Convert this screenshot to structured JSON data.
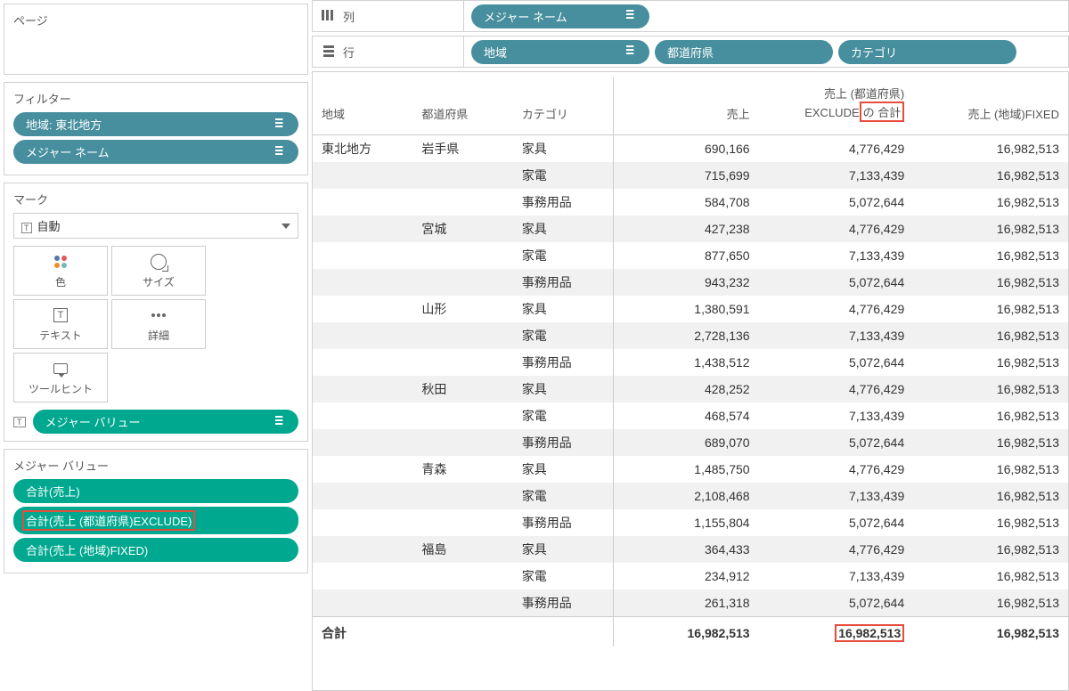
{
  "left": {
    "pages": {
      "title": "ページ"
    },
    "filters": {
      "title": "フィルター",
      "items": [
        {
          "label": "地域: 東北地方"
        },
        {
          "label": "メジャー ネーム"
        }
      ]
    },
    "marks": {
      "title": "マーク",
      "select_label": "自動",
      "buttons": {
        "color": "色",
        "size": "サイズ",
        "text": "テキスト",
        "detail": "詳細",
        "tooltip": "ツールヒント"
      },
      "measure_value_pill": "メジャー バリュー"
    },
    "measure_values": {
      "title": "メジャー バリュー",
      "items": [
        {
          "label": "合計(売上)"
        },
        {
          "label": "合計(売上 (都道府県)EXCLUDE)",
          "highlight": true
        },
        {
          "label": "合計(売上 (地域)FIXED)"
        }
      ]
    }
  },
  "shelves": {
    "columns": {
      "label": "列",
      "pills": [
        "メジャー ネーム"
      ]
    },
    "rows": {
      "label": "行",
      "pills": [
        "地域",
        "都道府県",
        "カテゴリ"
      ]
    }
  },
  "table": {
    "headers": {
      "region": "地域",
      "prefecture": "都道府県",
      "category": "カテゴリ",
      "sales": "売上",
      "exclude_line1": "売上 (都道府県)",
      "exclude_line2a": "EXCLUDE",
      "exclude_line2b": " の 合計",
      "fixed": "売上 (地域)FIXED"
    },
    "region_value": "東北地方",
    "total_label": "合計",
    "totals": {
      "sales": "16,982,513",
      "exclude": "16,982,513",
      "fixed": "16,982,513"
    },
    "prefectures": [
      {
        "name": "岩手県",
        "rows": [
          {
            "cat": "家具",
            "sales": "690,166",
            "exclude": "4,776,429",
            "fixed": "16,982,513"
          },
          {
            "cat": "家電",
            "sales": "715,699",
            "exclude": "7,133,439",
            "fixed": "16,982,513",
            "stripe": true
          },
          {
            "cat": "事務用品",
            "sales": "584,708",
            "exclude": "5,072,644",
            "fixed": "16,982,513"
          }
        ]
      },
      {
        "name": "宮城",
        "rows": [
          {
            "cat": "家具",
            "sales": "427,238",
            "exclude": "4,776,429",
            "fixed": "16,982,513",
            "stripe": true
          },
          {
            "cat": "家電",
            "sales": "877,650",
            "exclude": "7,133,439",
            "fixed": "16,982,513"
          },
          {
            "cat": "事務用品",
            "sales": "943,232",
            "exclude": "5,072,644",
            "fixed": "16,982,513",
            "stripe": true
          }
        ]
      },
      {
        "name": "山形",
        "rows": [
          {
            "cat": "家具",
            "sales": "1,380,591",
            "exclude": "4,776,429",
            "fixed": "16,982,513"
          },
          {
            "cat": "家電",
            "sales": "2,728,136",
            "exclude": "7,133,439",
            "fixed": "16,982,513",
            "stripe": true
          },
          {
            "cat": "事務用品",
            "sales": "1,438,512",
            "exclude": "5,072,644",
            "fixed": "16,982,513"
          }
        ]
      },
      {
        "name": "秋田",
        "rows": [
          {
            "cat": "家具",
            "sales": "428,252",
            "exclude": "4,776,429",
            "fixed": "16,982,513",
            "stripe": true
          },
          {
            "cat": "家電",
            "sales": "468,574",
            "exclude": "7,133,439",
            "fixed": "16,982,513"
          },
          {
            "cat": "事務用品",
            "sales": "689,070",
            "exclude": "5,072,644",
            "fixed": "16,982,513",
            "stripe": true
          }
        ]
      },
      {
        "name": "青森",
        "rows": [
          {
            "cat": "家具",
            "sales": "1,485,750",
            "exclude": "4,776,429",
            "fixed": "16,982,513"
          },
          {
            "cat": "家電",
            "sales": "2,108,468",
            "exclude": "7,133,439",
            "fixed": "16,982,513",
            "stripe": true
          },
          {
            "cat": "事務用品",
            "sales": "1,155,804",
            "exclude": "5,072,644",
            "fixed": "16,982,513"
          }
        ]
      },
      {
        "name": "福島",
        "rows": [
          {
            "cat": "家具",
            "sales": "364,433",
            "exclude": "4,776,429",
            "fixed": "16,982,513",
            "stripe": true
          },
          {
            "cat": "家電",
            "sales": "234,912",
            "exclude": "7,133,439",
            "fixed": "16,982,513"
          },
          {
            "cat": "事務用品",
            "sales": "261,318",
            "exclude": "5,072,644",
            "fixed": "16,982,513",
            "stripe": true
          }
        ]
      }
    ]
  }
}
